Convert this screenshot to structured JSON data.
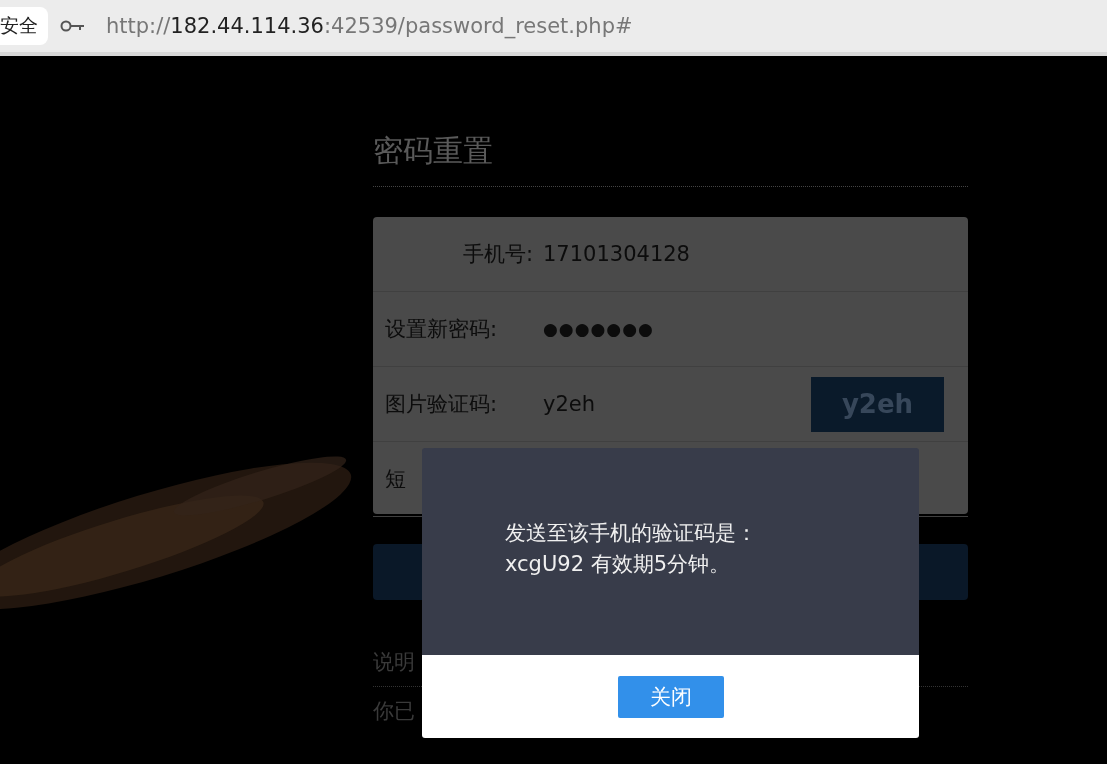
{
  "address_bar": {
    "security_label": "安全",
    "url": {
      "scheme": "http://",
      "host": "182.44.114.36",
      "rest": ":42539/password_reset.php#"
    }
  },
  "page": {
    "title": "密码重置",
    "fields": [
      {
        "kind": "text",
        "label": "手机号:",
        "value": "17101304128"
      },
      {
        "kind": "password",
        "label": "设置新密码:",
        "value": "●●●●●●●"
      },
      {
        "kind": "captcha",
        "label": "图片验证码:",
        "value": "y2eh",
        "captcha_image_text": "y2eh"
      },
      {
        "kind": "text",
        "label": "短"
      }
    ],
    "notes": [
      "说明",
      "你已"
    ]
  },
  "dialog": {
    "message": [
      "发送至该手机的验证码是：",
      "xcgU92 有效期5分钟。"
    ],
    "close_button": "关闭"
  }
}
